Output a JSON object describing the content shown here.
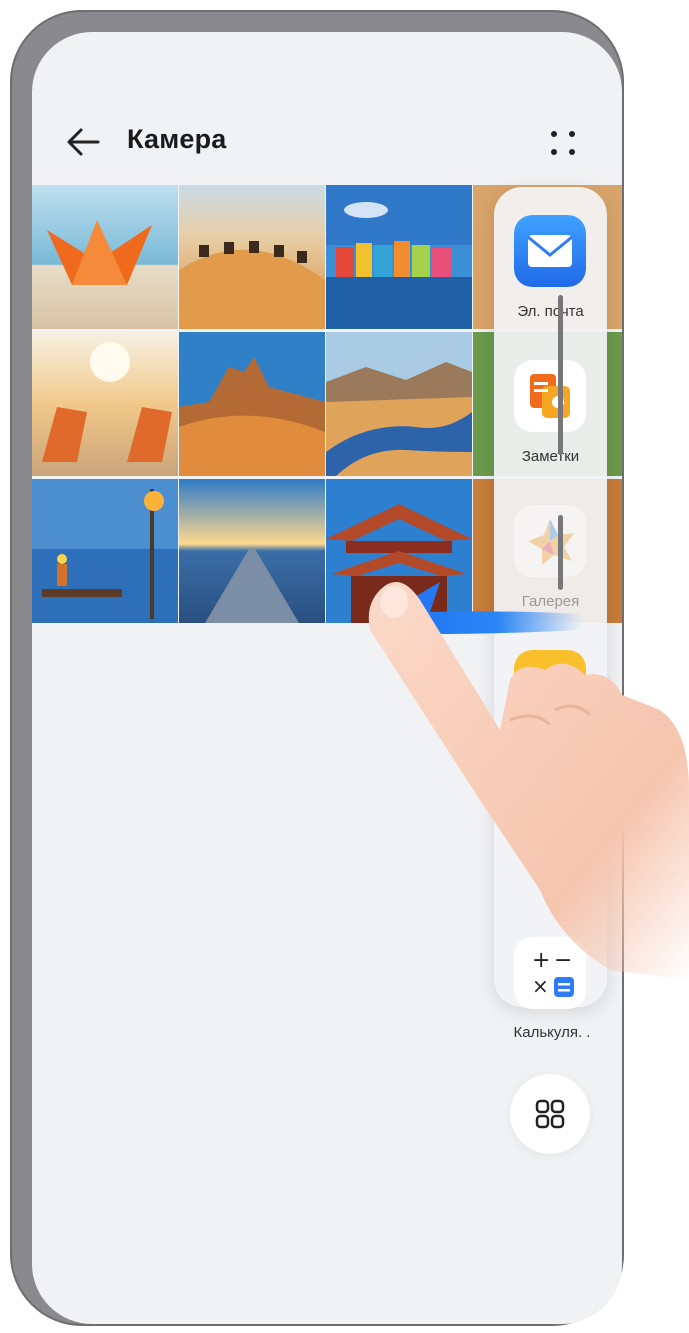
{
  "header": {
    "title": "Камера",
    "back_icon": "arrow-left-icon",
    "more_icon": "four-dots-icon"
  },
  "gallery": {
    "photos": [
      "paper-boat-on-beach",
      "camels-in-desert",
      "colorful-houses-by-water",
      "beach-chairs-at-sunset",
      "desert-rock-formation",
      "river-in-mountain-valley",
      "lantern-table-by-sea",
      "road-to-horizon",
      "chinese-pagoda-roof"
    ]
  },
  "dock": {
    "items": [
      {
        "label": "Эл. почта",
        "icon": "mail-icon",
        "color": "#2f7cf6"
      },
      {
        "label": "Заметки",
        "icon": "notes-icon",
        "color": "#f7931e"
      },
      {
        "label": "Галерея",
        "icon": "gallery-icon",
        "color": "#f4c430"
      },
      {
        "label": "",
        "icon": "files-icon",
        "color": "#f9c02b"
      },
      {
        "label": "Калькуля. .",
        "icon": "calculator-icon",
        "color": "#2f7cf6"
      }
    ],
    "all_apps_icon": "grid-apps-icon"
  },
  "gesture": {
    "arrow_icon": "swipe-left-arrow-icon",
    "hand_icon": "pointing-hand-icon",
    "accent_color": "#1e6ff0"
  }
}
